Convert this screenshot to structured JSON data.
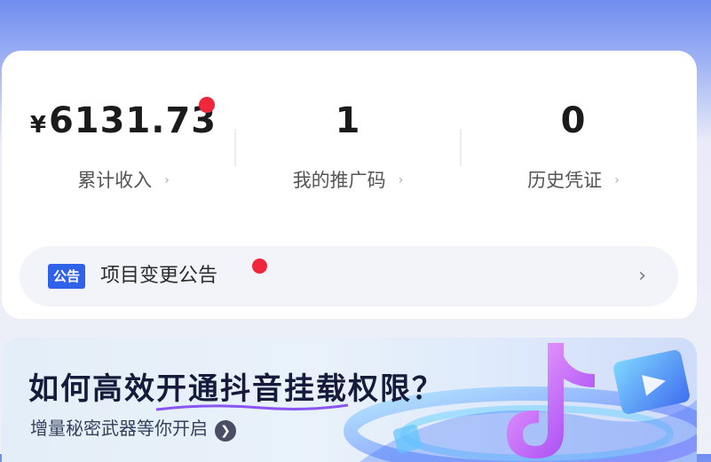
{
  "stats": [
    {
      "value": "6131.73",
      "currency": "¥",
      "label": "累计收入"
    },
    {
      "value": "1",
      "label": "我的推广码"
    },
    {
      "value": "0",
      "label": "历史凭证"
    }
  ],
  "notice": {
    "tag": "公告",
    "text": "项目变更公告"
  },
  "banner": {
    "title": "如何高效开通抖音挂载权限？",
    "subtitle": "增量秘密武器等你开启"
  },
  "colors": {
    "accent_blue": "#2f62e8",
    "badge_red": "#f0263a",
    "header_blue": "#6f8df0"
  },
  "icons": {
    "chevron": "chevron-right-icon",
    "go": "arrow-circle-icon"
  }
}
